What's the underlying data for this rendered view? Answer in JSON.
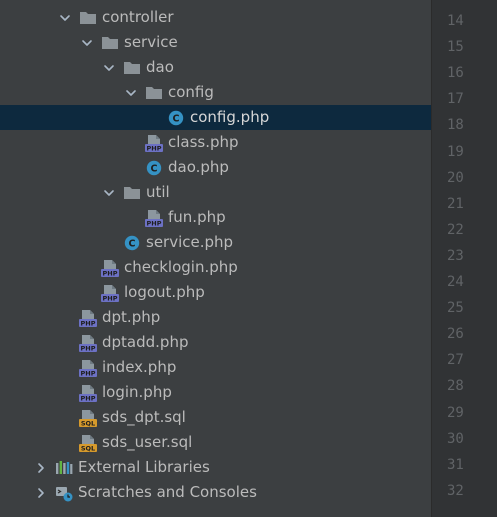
{
  "tree": {
    "rows": [
      {
        "label": "controller",
        "type": "folder",
        "expanded": true,
        "level": 0,
        "selected": false
      },
      {
        "label": "service",
        "type": "folder",
        "expanded": true,
        "level": 1,
        "selected": false
      },
      {
        "label": "dao",
        "type": "folder",
        "expanded": true,
        "level": 2,
        "selected": false
      },
      {
        "label": "config",
        "type": "folder",
        "expanded": true,
        "level": 3,
        "selected": false
      },
      {
        "label": "config.php",
        "type": "class-php",
        "level": 4,
        "selected": true
      },
      {
        "label": "class.php",
        "type": "php",
        "level": 3,
        "selected": false
      },
      {
        "label": "dao.php",
        "type": "class-php",
        "level": 3,
        "selected": false
      },
      {
        "label": "util",
        "type": "folder",
        "expanded": true,
        "level": 2,
        "selected": false
      },
      {
        "label": "fun.php",
        "type": "php",
        "level": 3,
        "selected": false
      },
      {
        "label": "service.php",
        "type": "class-php",
        "level": 2,
        "selected": false
      },
      {
        "label": "checklogin.php",
        "type": "php",
        "level": 1,
        "selected": false
      },
      {
        "label": "logout.php",
        "type": "php",
        "level": 1,
        "selected": false
      },
      {
        "label": "dpt.php",
        "type": "php",
        "level": 0,
        "selected": false
      },
      {
        "label": "dptadd.php",
        "type": "php",
        "level": 0,
        "selected": false
      },
      {
        "label": "index.php",
        "type": "php",
        "level": 0,
        "selected": false
      },
      {
        "label": "login.php",
        "type": "php",
        "level": 0,
        "selected": false
      },
      {
        "label": "sds_dpt.sql",
        "type": "sql",
        "level": 0,
        "selected": false
      },
      {
        "label": "sds_user.sql",
        "type": "sql",
        "level": 0,
        "selected": false
      },
      {
        "label": "External Libraries",
        "type": "libraries",
        "expanded": false,
        "level": -1,
        "selected": false
      },
      {
        "label": "Scratches and Consoles",
        "type": "scratches",
        "expanded": false,
        "level": -1,
        "selected": false
      }
    ],
    "icon_badges": {
      "php": "PHP",
      "sql": "SQL",
      "class": "C"
    }
  },
  "gutter": {
    "line_numbers": [
      "14",
      "15",
      "16",
      "17",
      "18",
      "19",
      "20",
      "21",
      "22",
      "23",
      "24",
      "25",
      "26",
      "27",
      "28",
      "29",
      "30",
      "31",
      "32"
    ]
  },
  "colors": {
    "tree_bg": "#3c3f41",
    "selected_bg": "#0d293e",
    "text": "#bbbbbb",
    "folder": "#8b9297",
    "class_icon": "#3592c4",
    "php_badge": "#6c71c4",
    "sql_badge": "#d69a2c",
    "gutter_bg": "#313335",
    "gutter_text": "#606366"
  }
}
